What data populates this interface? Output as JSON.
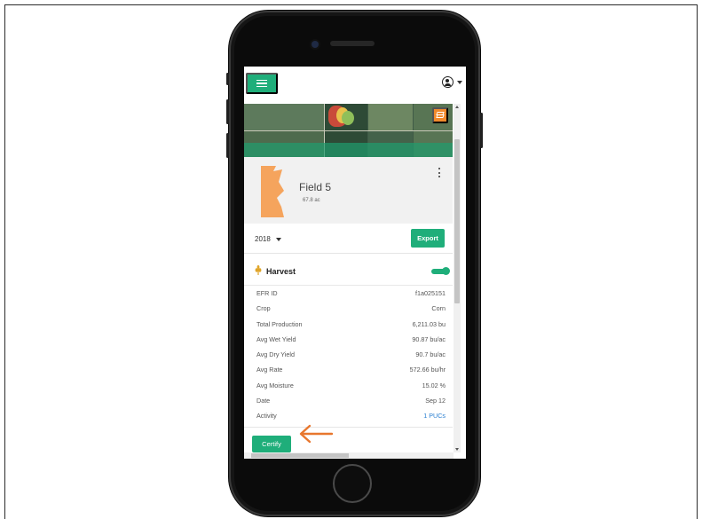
{
  "app": {
    "menu_icon": "menu-icon",
    "account_icon": "user-circle-icon"
  },
  "map": {
    "layers_icon": "layers-icon"
  },
  "field": {
    "name": "Field 5",
    "area": "67.8 ac",
    "shape_color": "#f5a45d",
    "more_icon": "more-vertical-icon"
  },
  "toolbar": {
    "year": "2018",
    "export_label": "Export"
  },
  "harvest": {
    "title": "Harvest",
    "enabled": true,
    "rows": [
      {
        "label": "EFR ID",
        "value": "f1a025151"
      },
      {
        "label": "Crop",
        "value": "Corn"
      },
      {
        "label": "Total Production",
        "value": "6,211.03 bu"
      },
      {
        "label": "Avg Wet Yield",
        "value": "90.87 bu/ac"
      },
      {
        "label": "Avg Dry Yield",
        "value": "90.7 bu/ac"
      },
      {
        "label": "Avg Rate",
        "value": "572.66 bu/hr"
      },
      {
        "label": "Avg Moisture",
        "value": "15.02 %"
      },
      {
        "label": "Date",
        "value": "Sep 12"
      },
      {
        "label": "Activity",
        "value": "1 PUCs"
      }
    ]
  },
  "actions": {
    "certify_label": "Certify"
  },
  "colors": {
    "accent": "#1fae7a",
    "annotation_arrow": "#e8772e",
    "link": "#2a7fd1"
  }
}
